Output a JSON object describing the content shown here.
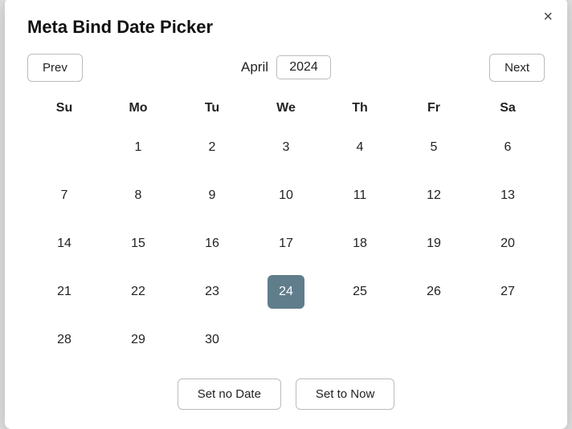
{
  "modal": {
    "title": "Meta Bind Date Picker",
    "close_label": "×"
  },
  "nav": {
    "prev_label": "Prev",
    "next_label": "Next",
    "month_label": "April",
    "year_value": "2024"
  },
  "weekdays": [
    "Su",
    "Mo",
    "Tu",
    "We",
    "Th",
    "Fr",
    "Sa"
  ],
  "weeks": [
    [
      "",
      "1",
      "2",
      "3",
      "4",
      "5",
      "6"
    ],
    [
      "7",
      "8",
      "9",
      "10",
      "11",
      "12",
      "13"
    ],
    [
      "14",
      "15",
      "16",
      "17",
      "18",
      "19",
      "20"
    ],
    [
      "21",
      "22",
      "23",
      "24",
      "25",
      "26",
      "27"
    ],
    [
      "28",
      "29",
      "30",
      "",
      "",
      "",
      ""
    ]
  ],
  "selected_day": "24",
  "actions": {
    "set_no_date_label": "Set no Date",
    "set_to_now_label": "Set to Now"
  }
}
